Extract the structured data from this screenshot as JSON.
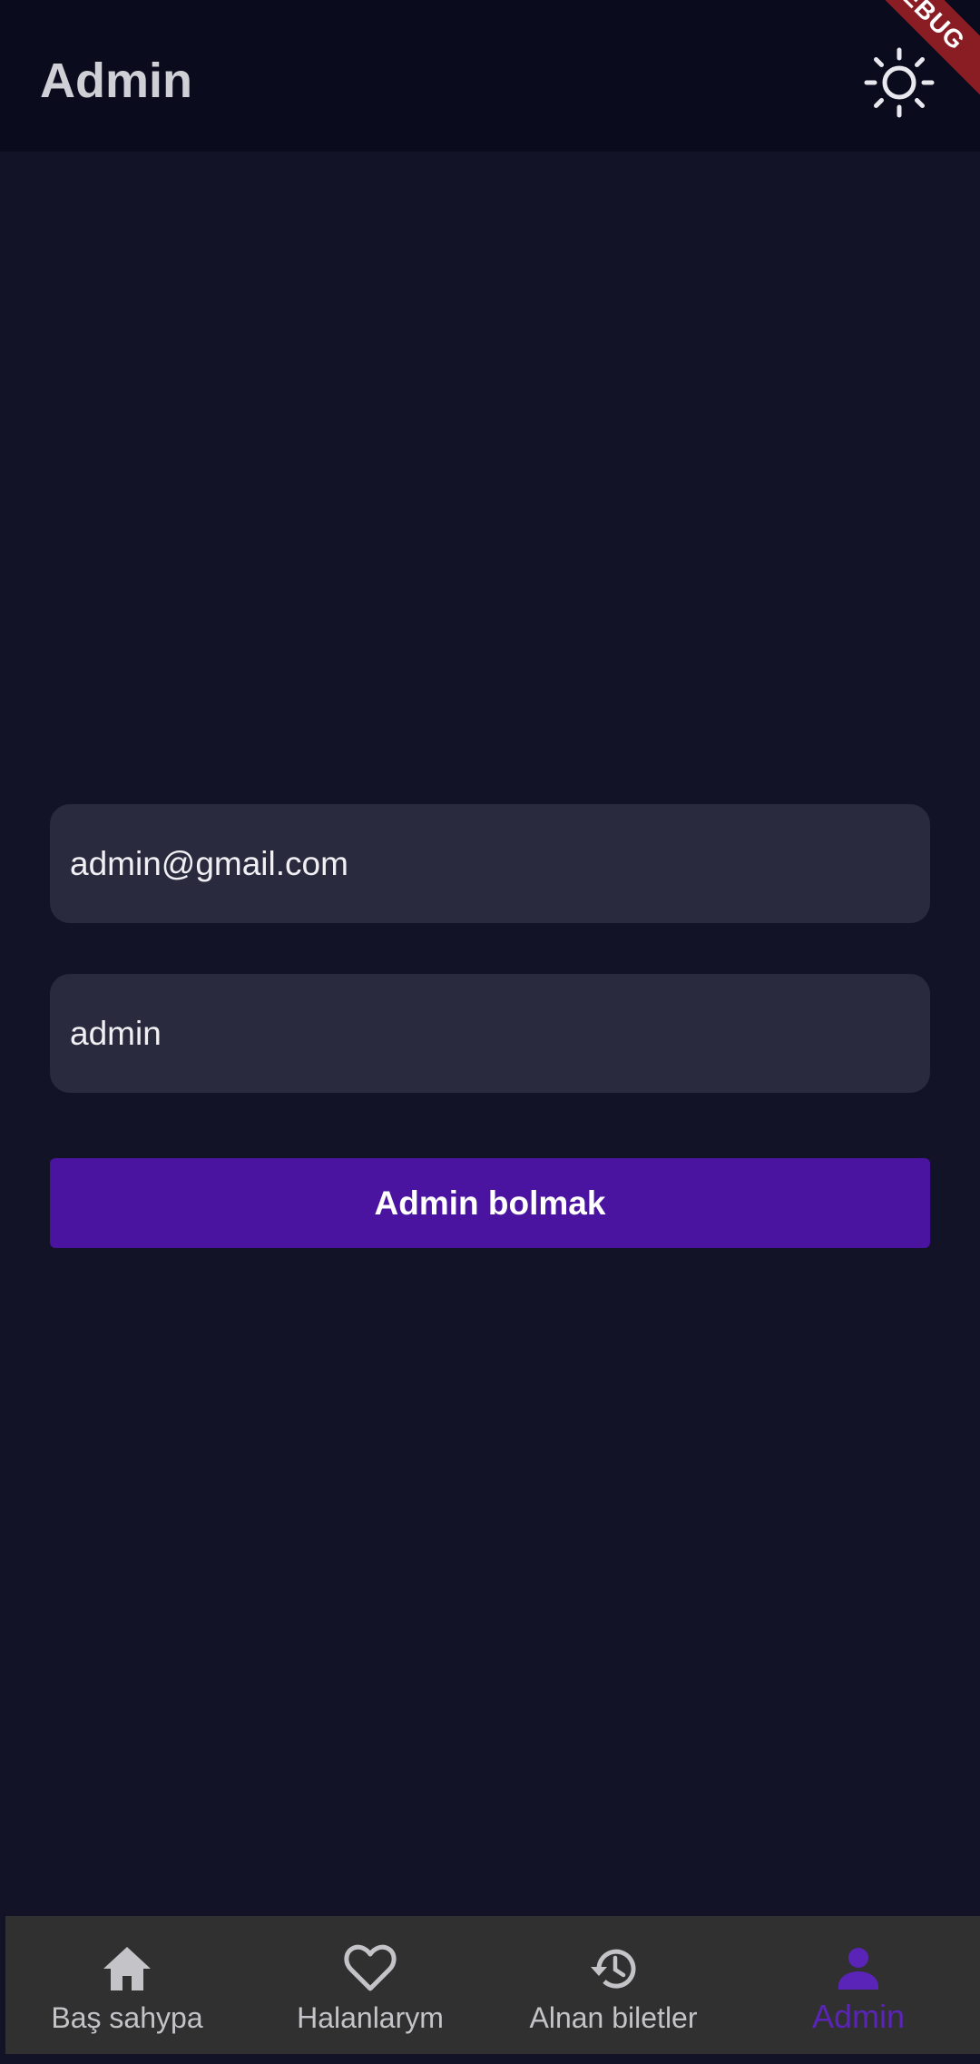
{
  "appbar": {
    "title": "Admin",
    "theme_toggle_icon": "sun-icon",
    "debug_label": "DEBUG"
  },
  "form": {
    "email_value": "admin@gmail.com",
    "password_value": "admin",
    "submit_label": "Admin bolmak"
  },
  "colors": {
    "background": "#131327",
    "appbar": "#0b0b1e",
    "field": "#2a2a3e",
    "primary": "#4a14a0",
    "nav_background": "#303030",
    "nav_active": "#5a24b8",
    "nav_inactive": "#c4c4c8"
  },
  "nav": {
    "items": [
      {
        "label": "Baş sahypa",
        "icon": "home-icon"
      },
      {
        "label": "Halanlarym",
        "icon": "heart-icon"
      },
      {
        "label": "Alnan biletler",
        "icon": "history-icon"
      },
      {
        "label": "Admin",
        "icon": "person-icon",
        "active": true
      }
    ]
  }
}
